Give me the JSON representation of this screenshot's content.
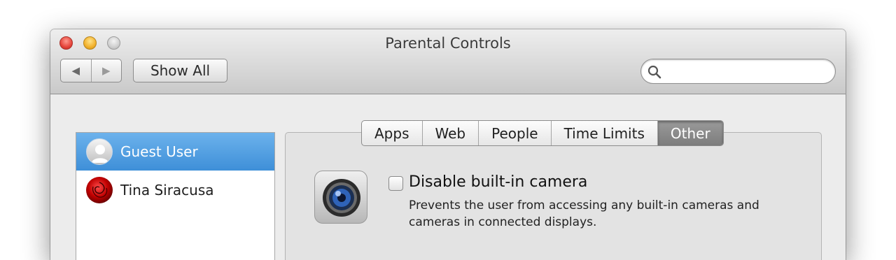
{
  "window": {
    "title": "Parental Controls",
    "traffic_lights": [
      "close",
      "minimize",
      "zoom"
    ]
  },
  "toolbar": {
    "back_icon": "◀",
    "forward_icon": "▶",
    "show_all_label": "Show All",
    "search": {
      "placeholder": "",
      "value": ""
    }
  },
  "users": [
    {
      "name": "Guest User",
      "avatar": "person-silhouette-icon",
      "selected": true
    },
    {
      "name": "Tina Siracusa",
      "avatar": "red-rose-icon",
      "selected": false
    }
  ],
  "tabs": [
    {
      "label": "Apps",
      "selected": false
    },
    {
      "label": "Web",
      "selected": false
    },
    {
      "label": "People",
      "selected": false
    },
    {
      "label": "Time Limits",
      "selected": false
    },
    {
      "label": "Other",
      "selected": true
    }
  ],
  "settings": {
    "camera": {
      "icon": "camera-icon",
      "label": "Disable built-in camera",
      "checked": false,
      "description": "Prevents the user from accessing any built-in cameras and cameras in connected displays."
    }
  },
  "colors": {
    "selection_blue": "#4a9ae0",
    "selected_tab": "#8a8a8a"
  }
}
